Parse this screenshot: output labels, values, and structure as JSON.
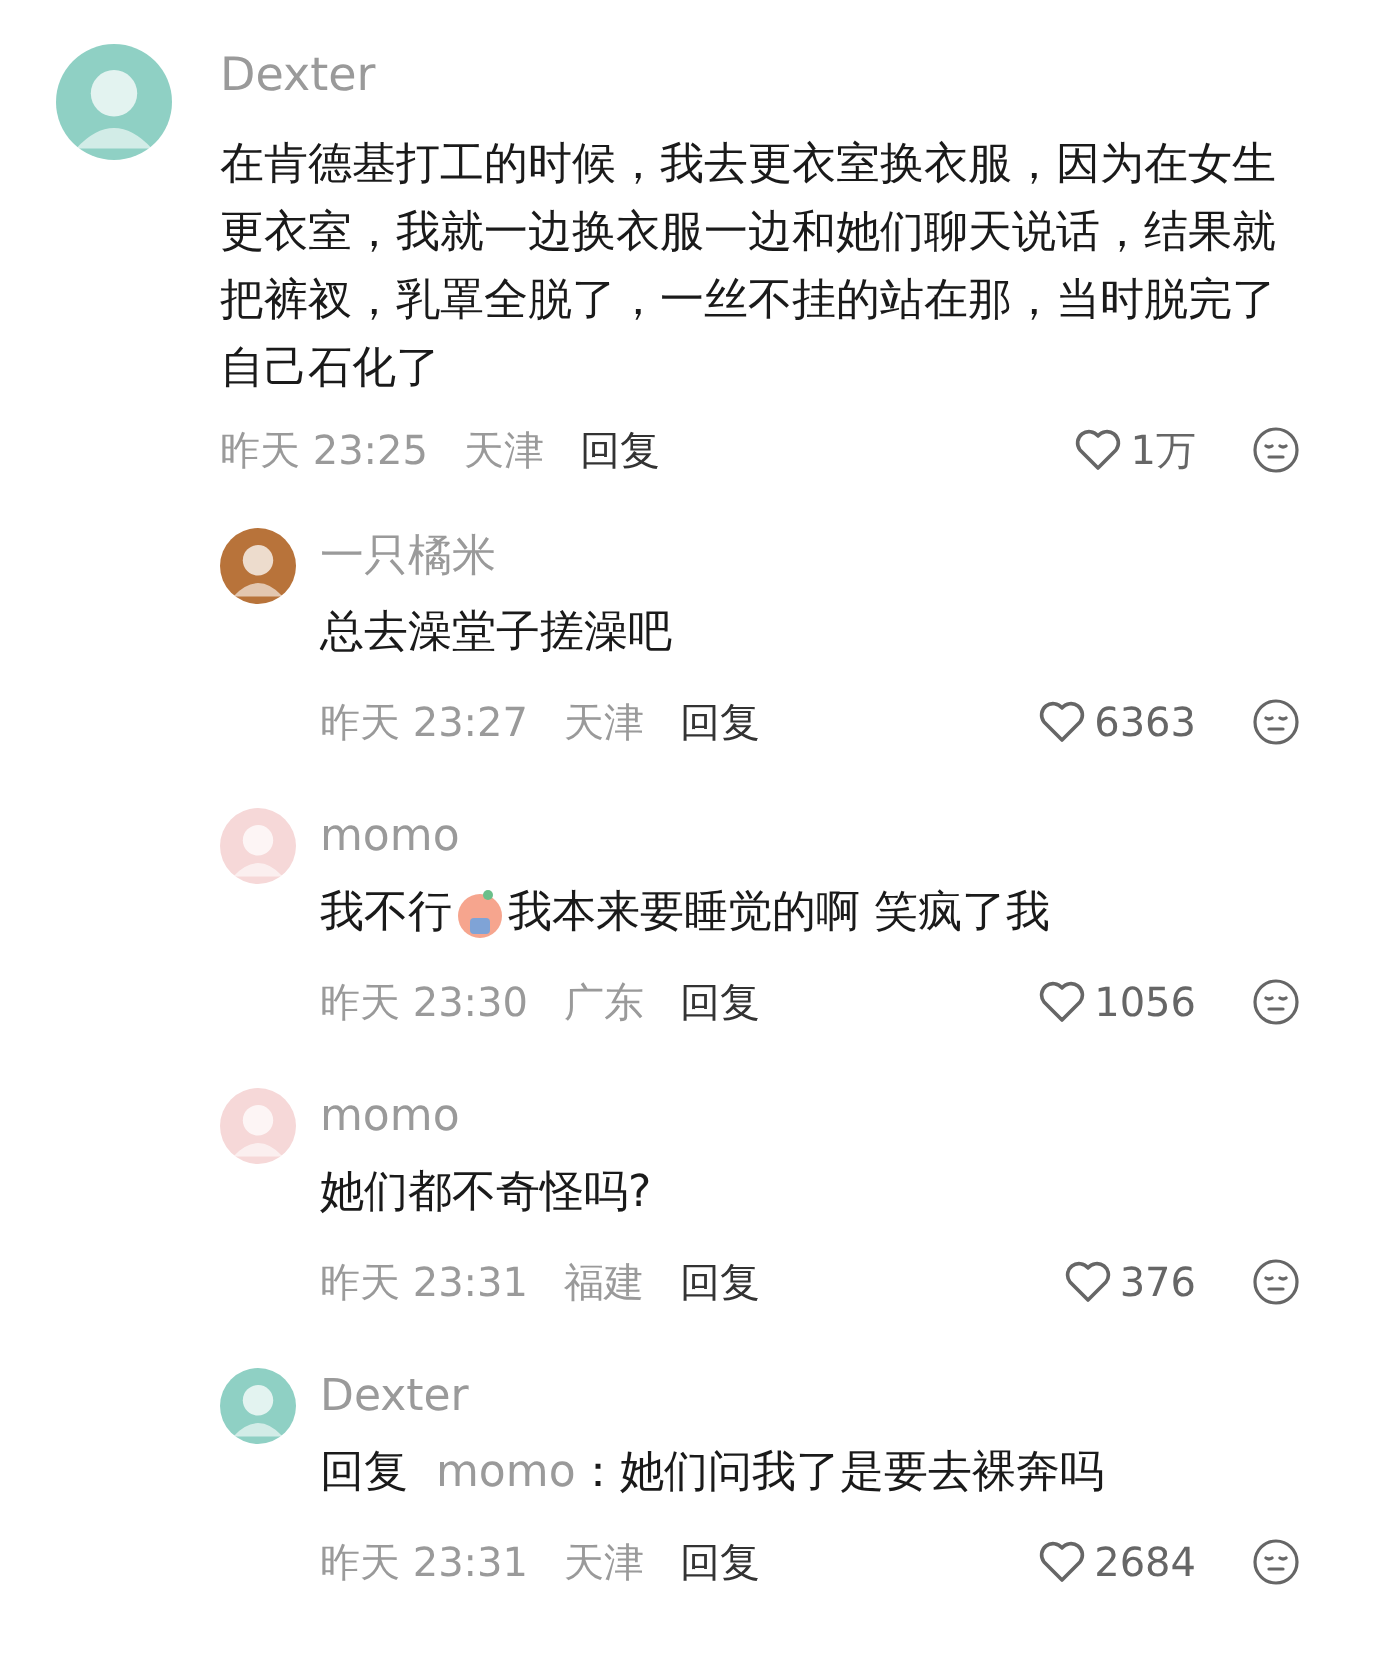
{
  "comment": {
    "user": "Dexter",
    "avatar": {
      "color": "#8fd0c4"
    },
    "text": "在肯德基打工的时候，我去更衣室换衣服，因为在女生更衣室，我就一边换衣服一边和她们聊天说话，结果就把裤衩，乳罩全脱了，一丝不挂的站在那，当时脱完了自己石化了",
    "time": "昨天 23:25",
    "location": "天津",
    "reply_label": "回复",
    "likes": "1万",
    "liked": false,
    "replies": [
      {
        "user": "一只橘米",
        "avatar": {
          "color": "#b8733a"
        },
        "segments": [
          {
            "kind": "text",
            "text": "总去澡堂子搓澡吧"
          }
        ],
        "time": "昨天 23:27",
        "location": "天津",
        "reply_label": "回复",
        "likes": "6363",
        "liked": false
      },
      {
        "user": "momo",
        "avatar": {
          "color": "#f6d8d8"
        },
        "segments": [
          {
            "kind": "text",
            "text": "我不行"
          },
          {
            "kind": "emoji"
          },
          {
            "kind": "text",
            "text": "我本来要睡觉的啊 笑疯了我"
          }
        ],
        "time": "昨天 23:30",
        "location": "广东",
        "reply_label": "回复",
        "likes": "1056",
        "liked": false
      },
      {
        "user": "momo",
        "avatar": {
          "color": "#f6d8d8"
        },
        "segments": [
          {
            "kind": "text",
            "text": "她们都不奇怪吗?"
          }
        ],
        "time": "昨天 23:31",
        "location": "福建",
        "reply_label": "回复",
        "likes": "376",
        "liked": false
      },
      {
        "user": "Dexter",
        "avatar": {
          "color": "#8fd0c4"
        },
        "reply_to": {
          "label": "回复",
          "user": "momo"
        },
        "segments": [
          {
            "kind": "text",
            "text": "：她们问我了是要去裸奔吗"
          }
        ],
        "time": "昨天 23:31",
        "location": "天津",
        "reply_label": "回复",
        "likes": "2684",
        "liked": false
      }
    ]
  }
}
